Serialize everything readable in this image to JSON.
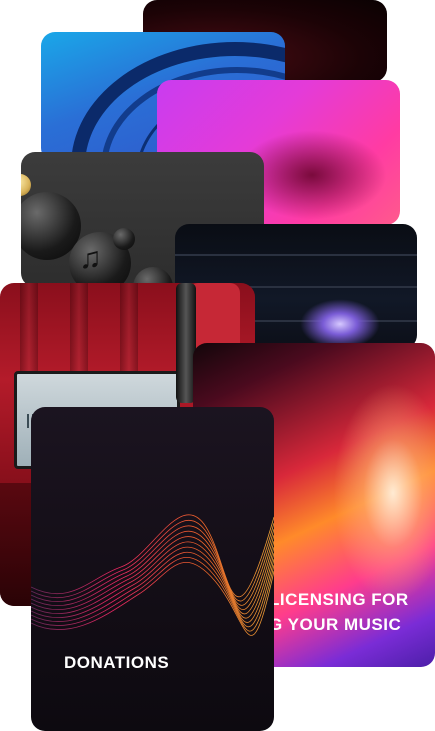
{
  "cards": {
    "licensing": {
      "line1": "LICENSING FOR",
      "line2": "G YOUR MUSIC"
    },
    "donations": {
      "title": "DONATIONS"
    }
  },
  "colors": {
    "dark_red": "#4a0c14",
    "blue": "#2a6fd6",
    "magenta": "#e43bd8",
    "charcoal": "#2d2d2d",
    "navy": "#111827",
    "studio_red": "#b41b2a",
    "sunset_orange": "#ff8a2a",
    "violet": "#7a2cd6",
    "dark_plum": "#140e17"
  },
  "icons": [
    "music-note-icon"
  ]
}
